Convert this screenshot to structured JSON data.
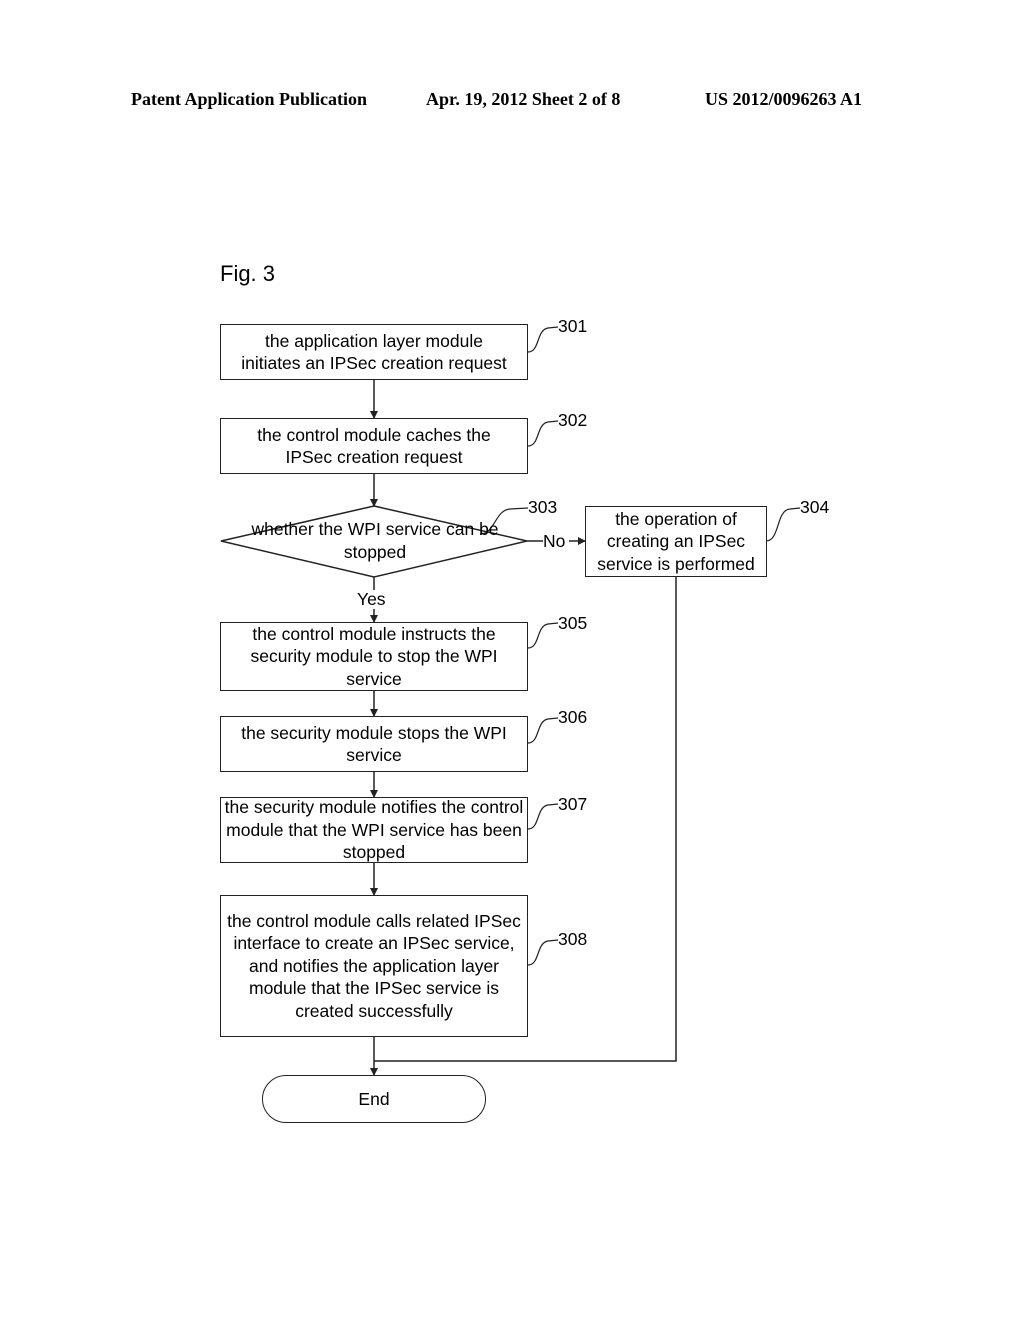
{
  "header": {
    "publication": "Patent Application Publication",
    "date_sheet": "Apr. 19, 2012  Sheet 2 of 8",
    "number": "US 2012/0096263 A1"
  },
  "figure": {
    "label": "Fig. 3",
    "steps": {
      "s301": {
        "ref": "301",
        "text": "the application layer module initiates an IPSec creation request"
      },
      "s302": {
        "ref": "302",
        "text": "the control module caches the IPSec creation request"
      },
      "s303": {
        "ref": "303",
        "text": "whether the WPI service can be stopped"
      },
      "s304": {
        "ref": "304",
        "text": "the operation of creating an IPSec service is performed"
      },
      "s305": {
        "ref": "305",
        "text": "the control module instructs the security module to stop the WPI service"
      },
      "s306": {
        "ref": "306",
        "text": "the security module stops the WPI service"
      },
      "s307": {
        "ref": "307",
        "text": "the security module notifies the control module that the WPI service has been stopped"
      },
      "s308": {
        "ref": "308",
        "text": "the control module calls related IPSec interface to create an IPSec service, and notifies the application layer module that the IPSec service is created successfully"
      }
    },
    "branch_no": "No",
    "branch_yes": "Yes",
    "end": "End"
  }
}
